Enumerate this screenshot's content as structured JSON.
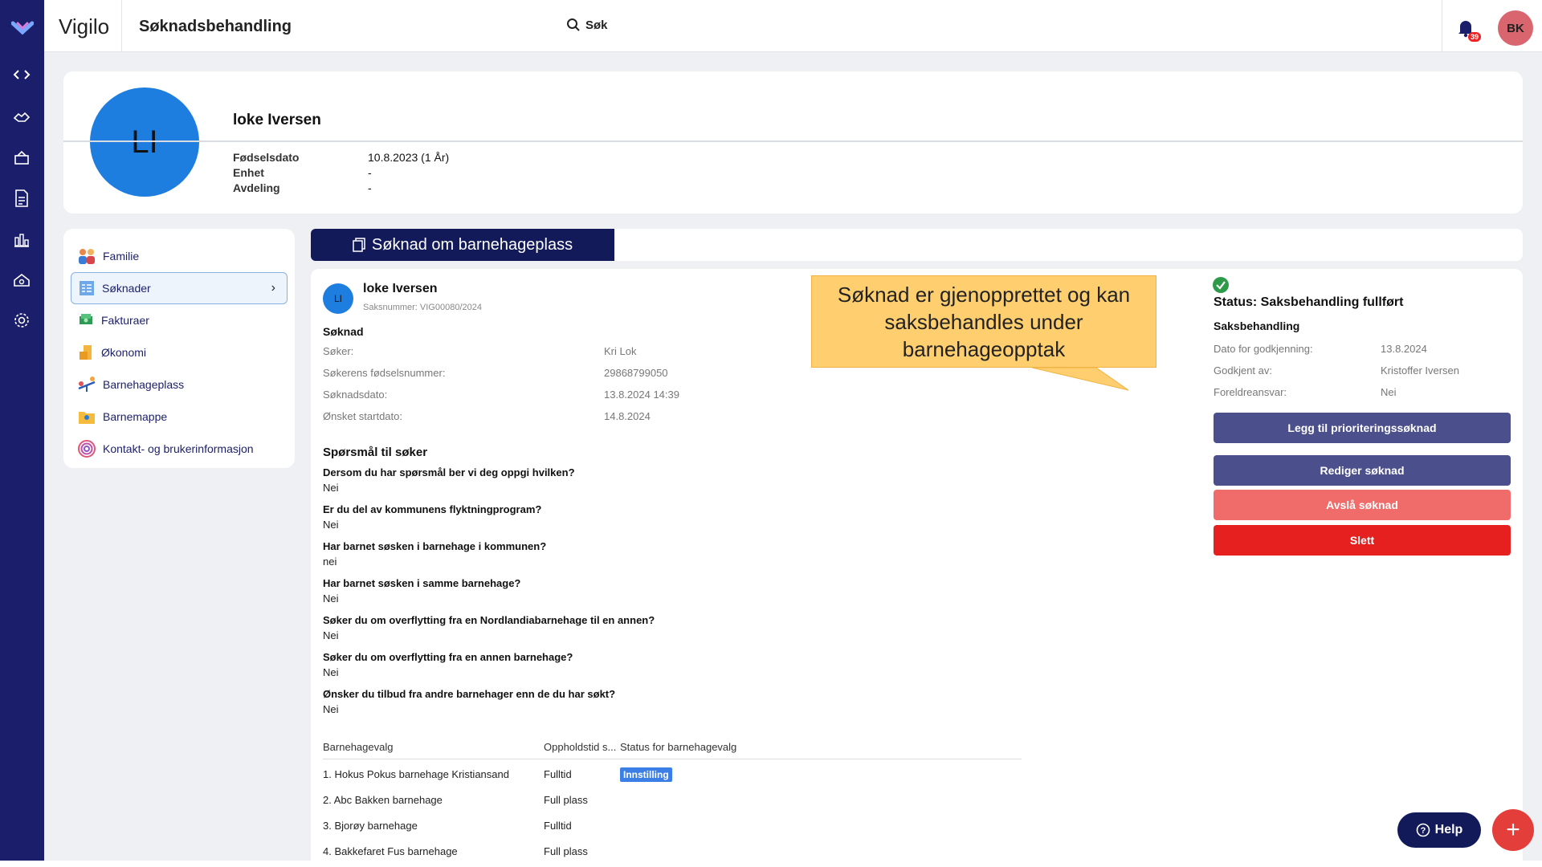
{
  "app": {
    "brand": "Vigilo",
    "title": "Søknadsbehandling",
    "search_label": "Søk",
    "notifications": "39",
    "user_initials": "BK"
  },
  "child": {
    "initials": "LI",
    "name": "loke Iversen",
    "fields": [
      {
        "label": "Fødselsdato",
        "value": "10.8.2023 (1 År)"
      },
      {
        "label": "Enhet",
        "value": "-"
      },
      {
        "label": "Avdeling",
        "value": "-"
      }
    ]
  },
  "nav": [
    {
      "label": "Familie",
      "icon": "family-icon"
    },
    {
      "label": "Søknader",
      "icon": "applications-icon"
    },
    {
      "label": "Fakturaer",
      "icon": "invoice-icon"
    },
    {
      "label": "Økonomi",
      "icon": "economy-icon"
    },
    {
      "label": "Barnehageplass",
      "icon": "kindergarten-place-icon"
    },
    {
      "label": "Barnemappe",
      "icon": "child-folder-icon"
    },
    {
      "label": "Kontakt- og brukerinformasjon",
      "icon": "contact-info-icon"
    }
  ],
  "tab": {
    "label": "Søknad om barnehageplass"
  },
  "application": {
    "initials": "LI",
    "name": "loke Iversen",
    "number": "Saksnummer: VIG00080/2024",
    "section_title": "Søknad",
    "rows": [
      {
        "label": "Søker:",
        "value": "Kri Lok"
      },
      {
        "label": "Søkerens fødselsnummer:",
        "value": "29868799050"
      },
      {
        "label": "Søknadsdato:",
        "value": "13.8.2024 14:39"
      },
      {
        "label": "Ønsket startdato:",
        "value": "14.8.2024"
      }
    ],
    "questions_title": "Spørsmål til søker",
    "questions": [
      {
        "q": "Dersom du har spørsmål ber vi deg oppgi hvilken?",
        "a": "Nei"
      },
      {
        "q": "Er du del av kommunens flyktningprogram?",
        "a": "Nei"
      },
      {
        "q": "Har barnet søsken i barnehage i kommunen?",
        "a": "nei"
      },
      {
        "q": "Har barnet søsken i samme barnehage?",
        "a": "Nei"
      },
      {
        "q": "Søker du om overflytting fra en Nordlandiabarnehage til en annen?",
        "a": "Nei"
      },
      {
        "q": "Søker du om overflytting fra en annen barnehage?",
        "a": "Nei"
      },
      {
        "q": "Ønsker du tilbud fra andre barnehager enn de du har søkt?",
        "a": "Nei"
      }
    ],
    "table": {
      "headers": [
        "Barnehagevalg",
        "Oppholdstid s...",
        "Status for barnehagevalg"
      ],
      "rows": [
        {
          "name": "1. Hokus Pokus barnehage Kristiansand",
          "time": "Fulltid",
          "status": "Innstilling"
        },
        {
          "name": "2. Abc Bakken barnehage",
          "time": "Full plass",
          "status": ""
        },
        {
          "name": "3. Bjorøy barnehage",
          "time": "Fulltid",
          "status": ""
        },
        {
          "name": "4. Bakkefaret Fus barnehage",
          "time": "Full plass",
          "status": ""
        }
      ]
    }
  },
  "callout": {
    "text": "Søknad er gjenopprettet og kan saksbehandles under barnehageopptak"
  },
  "status": {
    "title": "Status: Saksbehandling fullført",
    "subtitle": "Saksbehandling",
    "rows": [
      {
        "label": "Dato for godkjenning:",
        "value": "13.8.2024"
      },
      {
        "label": "Godkjent av:",
        "value": "Kristoffer Iversen"
      },
      {
        "label": "Foreldreansvar:",
        "value": "Nei"
      }
    ],
    "buttons": {
      "priority": "Legg til prioriteringssøknad",
      "edit": "Rediger søknad",
      "reject": "Avslå søknad",
      "delete": "Slett"
    }
  },
  "help": {
    "label": "Help"
  },
  "colors": {
    "rail": "#1b1f6b",
    "primary_btn": "#4b4f8c",
    "reject_btn": "#ef6c6a",
    "delete_btn": "#e5201f",
    "callout": "#ffcf6f"
  }
}
